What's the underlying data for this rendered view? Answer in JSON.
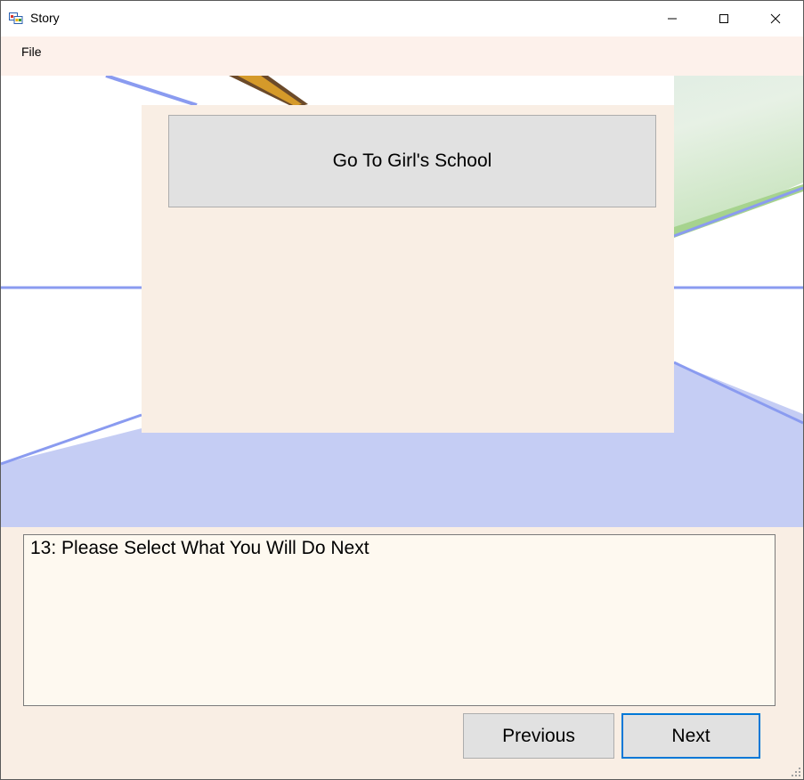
{
  "window": {
    "title": "Story",
    "controls": {
      "minimize_icon": "minimize-icon",
      "maximize_icon": "maximize-icon",
      "close_icon": "close-icon"
    }
  },
  "menu": {
    "items": [
      "File"
    ]
  },
  "choices": [
    {
      "label": "Go To Girl's School"
    }
  ],
  "narrative": {
    "text": "13: Please Select What You Will Do Next"
  },
  "navigation": {
    "previous_label": "Previous",
    "next_label": "Next"
  },
  "colors": {
    "background": "#f9eee4",
    "accent_focus": "#0078d7",
    "button_face": "#e1e1e1",
    "scene_floor": "#c5cdf4",
    "scene_lines": "#8a9bf0"
  }
}
